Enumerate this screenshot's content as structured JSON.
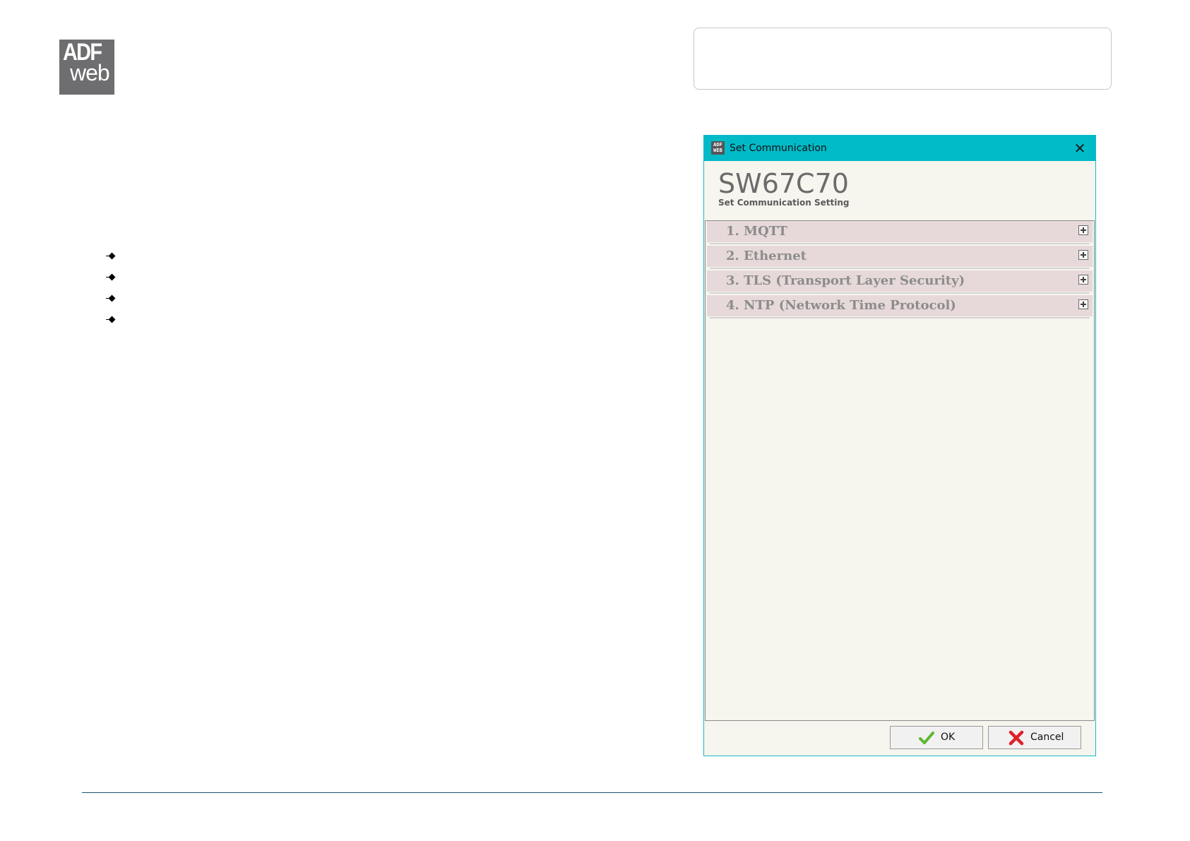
{
  "logo": {
    "line1": "ADF",
    "line2": "web"
  },
  "dialog": {
    "title": "Set Communication",
    "icon_text": "ADF WEB",
    "close_glyph": "✕",
    "device_name": "SW67C70",
    "subtitle": "Set Communication Setting",
    "sections": [
      {
        "label": "1. MQTT"
      },
      {
        "label": "2. Ethernet"
      },
      {
        "label": "3. TLS (Transport Layer Security)"
      },
      {
        "label": "4. NTP (Network Time Protocol)"
      }
    ],
    "ok_label": "OK",
    "cancel_label": "Cancel"
  },
  "colors": {
    "titlebar": "#00bac8",
    "dialog_bg": "#f6f5ee",
    "section_bg": "#e7d9d9",
    "section_text": "#8c8c8c",
    "ok_check": "#5cb82e",
    "cancel_x": "#e0202a",
    "footer_line": "#1e4f6b"
  },
  "icons": {
    "ok": "check-icon",
    "cancel": "x-icon",
    "expand": "plus-box-icon",
    "bullet": "diamond-bullet-icon"
  }
}
